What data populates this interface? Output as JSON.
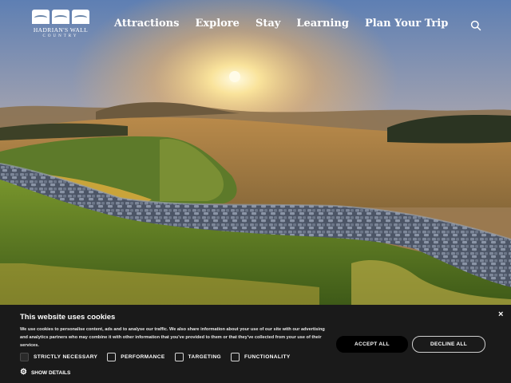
{
  "logo": {
    "name_line1": "HADRIAN'S WALL",
    "name_line2": "COUNTRY"
  },
  "nav": {
    "items": [
      {
        "label": "Attractions"
      },
      {
        "label": "Explore"
      },
      {
        "label": "Stay"
      },
      {
        "label": "Learning"
      },
      {
        "label": "Plan Your Trip"
      }
    ],
    "search_icon": "search-icon"
  },
  "hero": {
    "image_icon": "landscape-image"
  },
  "cookie": {
    "title": "This website uses cookies",
    "text": "We use cookies to personalise content, ads and to analyse our traffic. We also share information about your use of our site with our advertising and analytics partners who may combine it with other information that you've provided to them or that they've collected from your use of their services.",
    "accept_label": "ACCEPT ALL",
    "decline_label": "DECLINE ALL",
    "close_label": "×",
    "categories": [
      {
        "label": "STRICTLY NECESSARY",
        "checked": true
      },
      {
        "label": "PERFORMANCE",
        "checked": false
      },
      {
        "label": "TARGETING",
        "checked": false
      },
      {
        "label": "FUNCTIONALITY",
        "checked": false
      }
    ],
    "show_details_label": "SHOW DETAILS"
  },
  "colors": {
    "banner_bg": "#1a1a1a",
    "sky_top": "#5a7db1",
    "sun": "#ffe27a",
    "grass": "#6f8f2c"
  }
}
